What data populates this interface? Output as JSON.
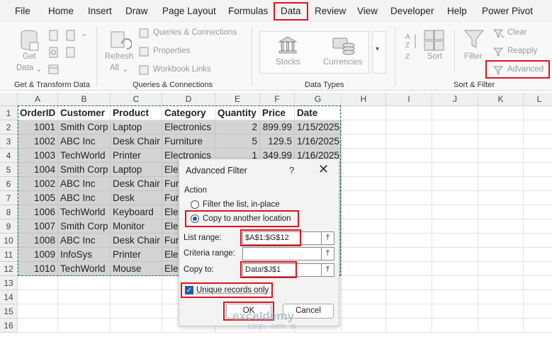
{
  "menu": {
    "items": [
      "File",
      "Home",
      "Insert",
      "Draw",
      "Page Layout",
      "Formulas",
      "Data",
      "Review",
      "View",
      "Developer",
      "Help",
      "Power Pivot"
    ],
    "active": "Data"
  },
  "ribbon": {
    "get_data_line1": "Get",
    "get_data_line2": "Data",
    "group_get_transform": "Get & Transform Data",
    "refresh_line1": "Refresh",
    "refresh_line2": "All",
    "queries_connections": "Queries & Connections",
    "properties": "Properties",
    "workbook_links": "Workbook Links",
    "group_queries": "Queries & Connections",
    "stocks": "Stocks",
    "currencies": "Currencies",
    "group_data_types": "Data Types",
    "sort": "Sort",
    "filter": "Filter",
    "clear": "Clear",
    "reapply": "Reapply",
    "advanced": "Advanced",
    "group_sort_filter": "Sort & Filter"
  },
  "columns": [
    "A",
    "B",
    "C",
    "D",
    "E",
    "F",
    "G",
    "H",
    "I",
    "J",
    "K",
    "L"
  ],
  "rows": [
    "1",
    "2",
    "3",
    "4",
    "5",
    "6",
    "7",
    "8",
    "9",
    "10",
    "11",
    "12",
    "13",
    "14",
    "15",
    "16"
  ],
  "table": {
    "headers": [
      "OrderID",
      "Customer",
      "Product",
      "Category",
      "Quantity",
      "Price",
      "Date"
    ],
    "rows": [
      [
        "1001",
        "Smith Corp",
        "Laptop",
        "Electronics",
        "2",
        "899.99",
        "1/15/2025"
      ],
      [
        "1002",
        "ABC Inc",
        "Desk Chair",
        "Furniture",
        "5",
        "129.5",
        "1/16/2025"
      ],
      [
        "1003",
        "TechWorld",
        "Printer",
        "Electronics",
        "1",
        "349.99",
        "1/16/2025"
      ],
      [
        "1004",
        "Smith Corp",
        "Laptop",
        "Elec",
        "",
        "",
        ""
      ],
      [
        "1002",
        "ABC Inc",
        "Desk Chair",
        "Fur",
        "",
        "",
        ""
      ],
      [
        "1005",
        "ABC Inc",
        "Desk",
        "Fur",
        "",
        "",
        ""
      ],
      [
        "1006",
        "TechWorld",
        "Keyboard",
        "Elec",
        "",
        "",
        ""
      ],
      [
        "1007",
        "Smith Corp",
        "Monitor",
        "Elec",
        "",
        "",
        ""
      ],
      [
        "1008",
        "ABC Inc",
        "Desk Chair",
        "Fur",
        "",
        "",
        ""
      ],
      [
        "1009",
        "InfoSys",
        "Printer",
        "Elec",
        "",
        "",
        ""
      ],
      [
        "1010",
        "TechWorld",
        "Mouse",
        "Elec",
        "",
        "",
        ""
      ]
    ]
  },
  "dialog": {
    "title": "Advanced Filter",
    "help": "?",
    "close": "✕",
    "action_label": "Action",
    "option_inplace": "Filter the list, in-place",
    "option_copy": "Copy to another location",
    "list_range_label": "List range:",
    "list_range_value": "$A$1:$G$12",
    "criteria_range_label": "Criteria range:",
    "criteria_range_value": "",
    "copy_to_label": "Copy to:",
    "copy_to_value": "Data!$J$1",
    "unique_label": "Unique records only",
    "ok": "OK",
    "cancel": "Cancel"
  },
  "watermark": {
    "brand": "exceldemy",
    "tagline": "EXCEL · DATA · BI"
  },
  "colors": {
    "highlight_red": "#e0141d",
    "selection_gray": "#d4d4d4",
    "excel_green": "#1e7145",
    "accent_blue": "#1a5ea8"
  }
}
